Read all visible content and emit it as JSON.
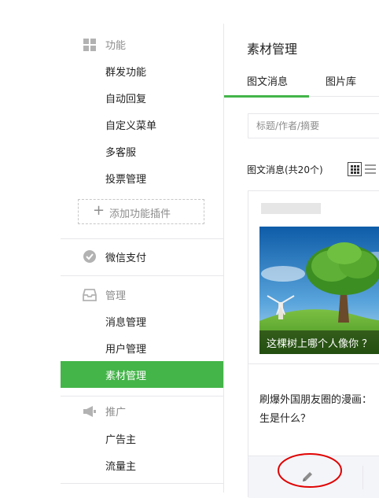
{
  "sidebar": {
    "function_header": "功能",
    "function_items": [
      "群发功能",
      "自动回复",
      "自定义菜单",
      "多客服",
      "投票管理"
    ],
    "add_plugin": "添加功能插件",
    "wechat_pay": "微信支付",
    "manage_header": "管理",
    "manage_items": [
      "消息管理",
      "用户管理",
      "素材管理"
    ],
    "active_item": "素材管理",
    "promo_header": "推广",
    "promo_items": [
      "广告主",
      "流量主"
    ]
  },
  "main": {
    "title": "素材管理",
    "tabs": [
      "图文消息",
      "图片库"
    ],
    "active_tab": "图文消息",
    "search_placeholder": "标题/作者/摘要",
    "count_label": "图文消息(共20个)",
    "card": {
      "cover_caption": "这棵树上哪个人像你 ？",
      "second_article": [
        "刷爆外国朋友圈的漫画：",
        "生是什么？"
      ]
    }
  },
  "colors": {
    "accent": "#44b549",
    "annotation": "#e00000"
  },
  "icons": {
    "function": "grid-icon",
    "pay": "wechat-pay-icon",
    "manage": "inbox-icon",
    "promo": "megaphone-icon",
    "edit": "pencil-icon"
  }
}
